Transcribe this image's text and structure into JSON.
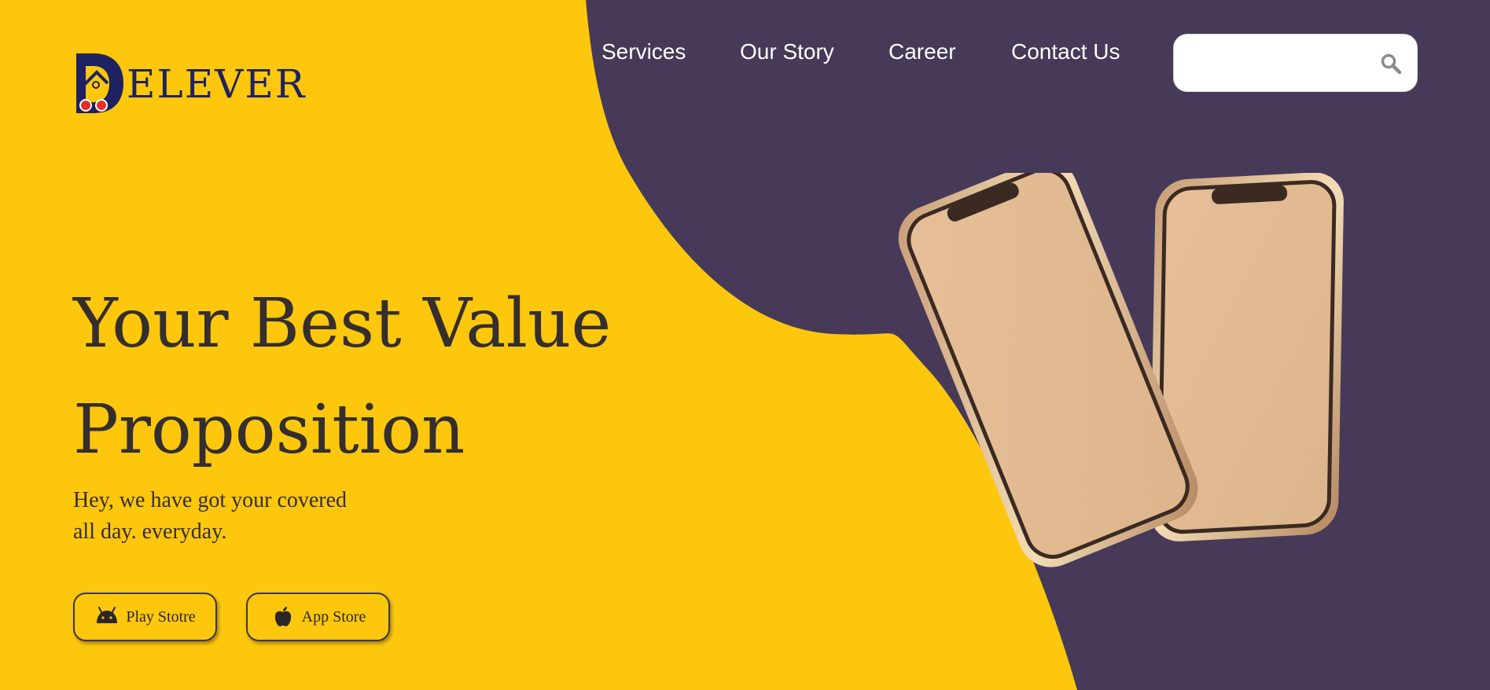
{
  "brand": {
    "name": "ELEVER",
    "logo_letter": "D"
  },
  "nav": {
    "items": [
      {
        "label": "Services"
      },
      {
        "label": "Our Story"
      },
      {
        "label": "Career"
      },
      {
        "label": "Contact Us"
      }
    ]
  },
  "search": {
    "value": "",
    "placeholder": "",
    "icon": "search-icon"
  },
  "hero": {
    "title_line1": "Your Best Value",
    "title_line2": "Proposition",
    "subtitle_line1": "Hey, we have got your covered",
    "subtitle_line2": "all day. everyday."
  },
  "buttons": {
    "play": {
      "label": "Play Stotre",
      "icon": "android-icon"
    },
    "app": {
      "label": "App Store",
      "icon": "apple-icon"
    }
  },
  "colors": {
    "yellow": "#fcc70d",
    "purple": "#463a58",
    "text_dark": "#352e2e",
    "brand_navy": "#1e2260",
    "phone_gold": "#e2bb94"
  }
}
